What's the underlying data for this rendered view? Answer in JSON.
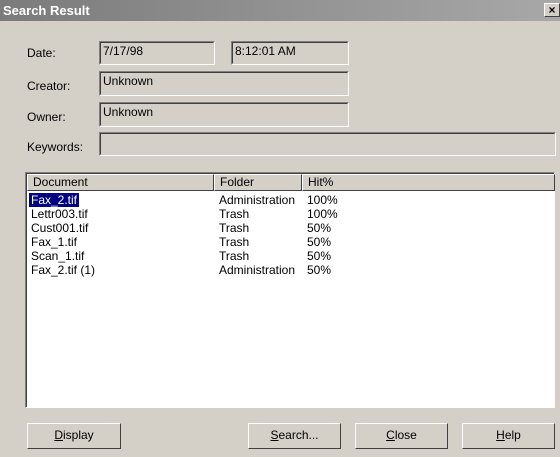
{
  "window": {
    "title": "Search Result",
    "close_glyph": "×"
  },
  "fields": {
    "date_label": "Date:",
    "date_value": "7/17/98",
    "time_value": "8:12:01 AM",
    "creator_label": "Creator:",
    "creator_value": "Unknown",
    "owner_label": "Owner:",
    "owner_value": "Unknown",
    "keywords_label": "Keywords:",
    "keywords_value": ""
  },
  "table": {
    "columns": [
      "Document",
      "Folder",
      "Hit%"
    ],
    "rows": [
      {
        "document": "Fax_2.tif",
        "folder": "Administration",
        "hit": "100%",
        "selected": true
      },
      {
        "document": "Lettr003.tif",
        "folder": "Trash",
        "hit": "100%"
      },
      {
        "document": "Cust001.tif",
        "folder": "Trash",
        "hit": "50%"
      },
      {
        "document": "Fax_1.tif",
        "folder": "Trash",
        "hit": "50%"
      },
      {
        "document": "Scan_1.tif",
        "folder": "Trash",
        "hit": "50%"
      },
      {
        "document": "Fax_2.tif (1)",
        "folder": "Administration",
        "hit": "50%"
      }
    ]
  },
  "buttons": {
    "display": {
      "accel": "D",
      "rest": "isplay"
    },
    "search": {
      "accel": "S",
      "rest": "earch..."
    },
    "close": {
      "accel": "C",
      "rest": "lose"
    },
    "help": {
      "accel": "H",
      "rest": "elp"
    }
  }
}
